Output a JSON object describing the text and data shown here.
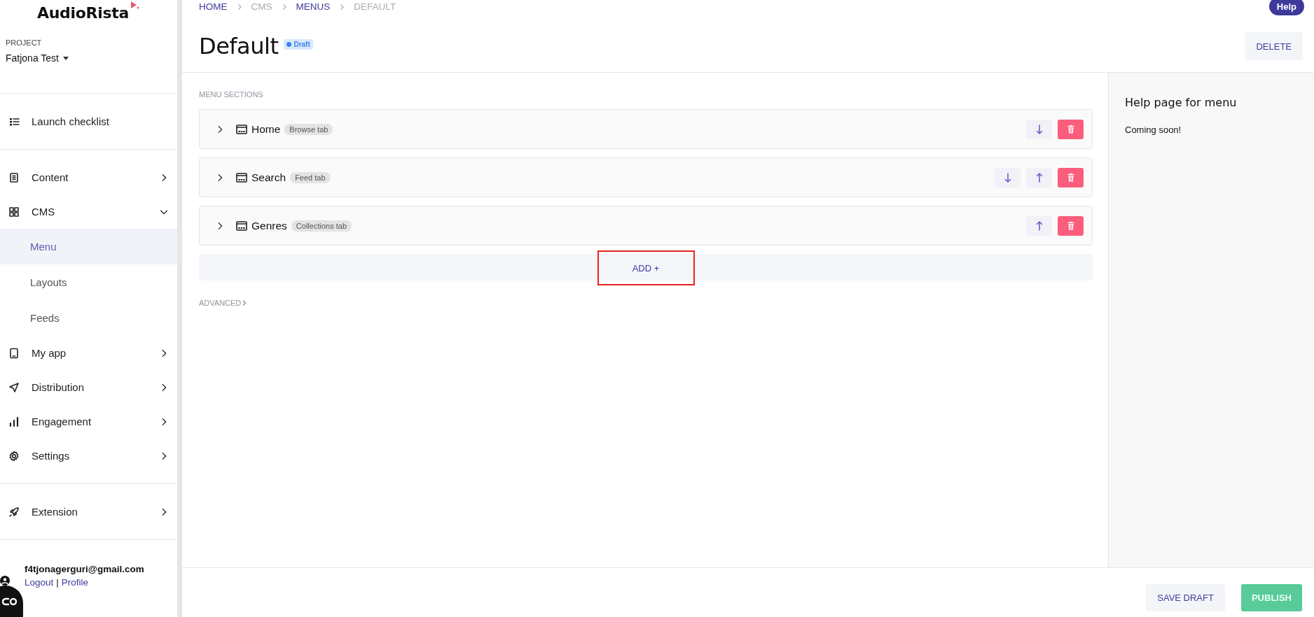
{
  "sidebar": {
    "logo": "AudioRista",
    "project_label": "PROJECT",
    "project": "Fatjona Test",
    "sections": [
      [
        {
          "label": "Launch checklist"
        }
      ],
      [
        {
          "label": "Content",
          "expanded": false
        },
        {
          "label": "CMS",
          "expanded": true,
          "children": [
            {
              "label": "Menu",
              "selected": true
            },
            {
              "label": "Layouts",
              "selected": false
            },
            {
              "label": "Feeds",
              "selected": false
            }
          ]
        },
        {
          "label": "My app",
          "expanded": false
        },
        {
          "label": "Distribution",
          "expanded": false
        },
        {
          "label": "Engagement",
          "expanded": false
        },
        {
          "label": "Settings",
          "expanded": false
        }
      ],
      [
        {
          "label": "Extension",
          "expanded": false
        }
      ]
    ],
    "user": {
      "email": "f4tjonagerguri@gmail.com",
      "links": [
        "Logout",
        "Profile"
      ],
      "separator": "|"
    }
  },
  "breadcrumb": [
    {
      "label": "HOME",
      "link": true
    },
    {
      "label": "CMS",
      "link": false
    },
    {
      "label": "MENUS",
      "link": true
    },
    {
      "label": "DEFAULT",
      "link": false
    }
  ],
  "help_button": "Help",
  "title": "Default",
  "status_badge": "Draft",
  "delete_button": "DELETE",
  "sections_heading": "MENU SECTIONS",
  "menu_sections": [
    {
      "name": "Home",
      "tag": "Browse tab",
      "move_down": true,
      "move_up": false
    },
    {
      "name": "Search",
      "tag": "Feed tab",
      "move_down": true,
      "move_up": true
    },
    {
      "name": "Genres",
      "tag": "Collections tab",
      "move_down": false,
      "move_up": true
    }
  ],
  "add_button": {
    "label": "ADD +",
    "highlighted": true
  },
  "advanced": "ADVANCED",
  "help_panel": {
    "title": "Help page for menu",
    "text": "Coming soon!"
  },
  "footer": {
    "save_button": "SAVE DRAFT",
    "publish_button": "PUBLISH"
  }
}
